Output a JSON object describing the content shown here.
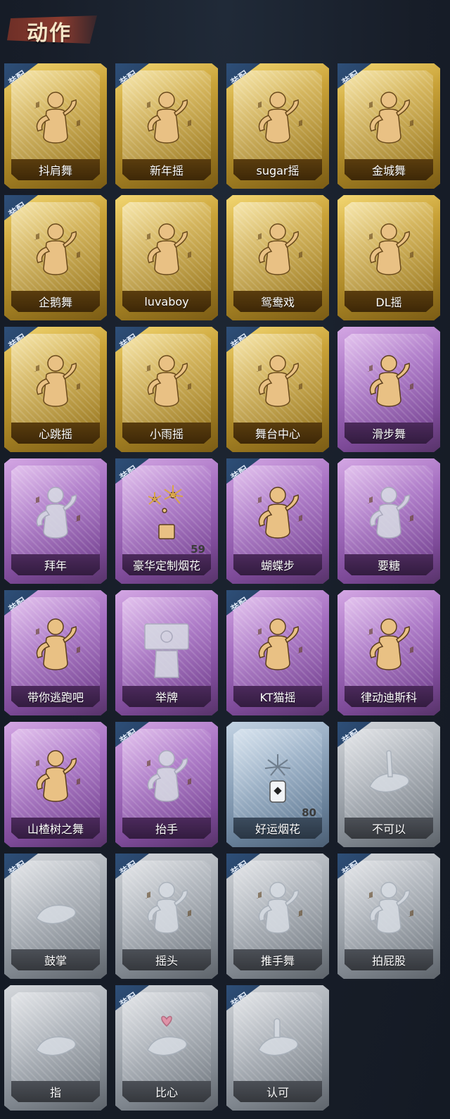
{
  "header": {
    "title": "动作"
  },
  "badge_text": "装配",
  "cards": [
    {
      "label": "抖肩舞",
      "rarity": "gold",
      "equipped": true,
      "icon": "dance-figure-icon"
    },
    {
      "label": "新年摇",
      "rarity": "gold",
      "equipped": true,
      "icon": "dance-figure-icon"
    },
    {
      "label": "sugar摇",
      "rarity": "gold",
      "equipped": true,
      "icon": "dance-figure-icon"
    },
    {
      "label": "金城舞",
      "rarity": "gold",
      "equipped": true,
      "icon": "dance-figure-icon"
    },
    {
      "label": "企鹅舞",
      "rarity": "gold",
      "equipped": true,
      "icon": "dance-figure-icon"
    },
    {
      "label": "luvaboy",
      "rarity": "gold",
      "equipped": false,
      "icon": "dance-figure-icon"
    },
    {
      "label": "鸳鸯戏",
      "rarity": "gold",
      "equipped": false,
      "icon": "dance-figure-icon"
    },
    {
      "label": "DL摇",
      "rarity": "gold",
      "equipped": false,
      "icon": "dance-figure-icon"
    },
    {
      "label": "心跳摇",
      "rarity": "gold",
      "equipped": true,
      "icon": "dance-figure-icon"
    },
    {
      "label": "小雨摇",
      "rarity": "gold",
      "equipped": true,
      "icon": "dance-figure-icon"
    },
    {
      "label": "舞台中心",
      "rarity": "gold",
      "equipped": true,
      "icon": "dance-figure-icon"
    },
    {
      "label": "滑步舞",
      "rarity": "purple",
      "equipped": false,
      "icon": "dance-figure-icon"
    },
    {
      "label": "拜年",
      "rarity": "purple",
      "equipped": false,
      "icon": "bow-figure-icon",
      "faded": true
    },
    {
      "label": "豪华定制烟花",
      "rarity": "purple",
      "equipped": true,
      "icon": "fireworks-box-icon",
      "count": "59"
    },
    {
      "label": "蝴蝶步",
      "rarity": "purple",
      "equipped": true,
      "icon": "dance-figure-icon"
    },
    {
      "label": "要糖",
      "rarity": "purple",
      "equipped": false,
      "icon": "beg-figure-icon",
      "faded": true
    },
    {
      "label": "带你逃跑吧",
      "rarity": "purple",
      "equipped": true,
      "icon": "dance-figure-icon"
    },
    {
      "label": "举牌",
      "rarity": "purple",
      "equipped": false,
      "icon": "sign-figure-icon",
      "faded": true
    },
    {
      "label": "KT猫摇",
      "rarity": "purple",
      "equipped": true,
      "icon": "dance-figure-icon"
    },
    {
      "label": "律动迪斯科",
      "rarity": "purple",
      "equipped": false,
      "icon": "dance-figure-icon"
    },
    {
      "label": "山楂树之舞",
      "rarity": "purple",
      "equipped": false,
      "icon": "dance-figure-icon"
    },
    {
      "label": "抬手",
      "rarity": "purple",
      "equipped": true,
      "icon": "raise-hand-figure-icon",
      "faded": true
    },
    {
      "label": "好运烟花",
      "rarity": "blue",
      "equipped": false,
      "icon": "fireworks-can-icon",
      "count": "80"
    },
    {
      "label": "不可以",
      "rarity": "gray",
      "equipped": true,
      "icon": "finger-wag-icon",
      "faded": true
    },
    {
      "label": "鼓掌",
      "rarity": "gray",
      "equipped": true,
      "icon": "clap-hands-icon",
      "faded": true
    },
    {
      "label": "摇头",
      "rarity": "gray",
      "equipped": true,
      "icon": "shake-head-figure-icon",
      "faded": true
    },
    {
      "label": "推手舞",
      "rarity": "gray",
      "equipped": true,
      "icon": "push-hands-figure-icon",
      "faded": true
    },
    {
      "label": "拍屁股",
      "rarity": "gray",
      "equipped": true,
      "icon": "slap-figure-icon",
      "faded": true
    },
    {
      "label": "指",
      "rarity": "gray",
      "equipped": false,
      "icon": "point-hand-icon",
      "faded": true
    },
    {
      "label": "比心",
      "rarity": "gray",
      "equipped": true,
      "icon": "finger-heart-icon",
      "faded": true
    },
    {
      "label": "认可",
      "rarity": "gray",
      "equipped": true,
      "icon": "thumbs-up-icon",
      "faded": true
    }
  ]
}
